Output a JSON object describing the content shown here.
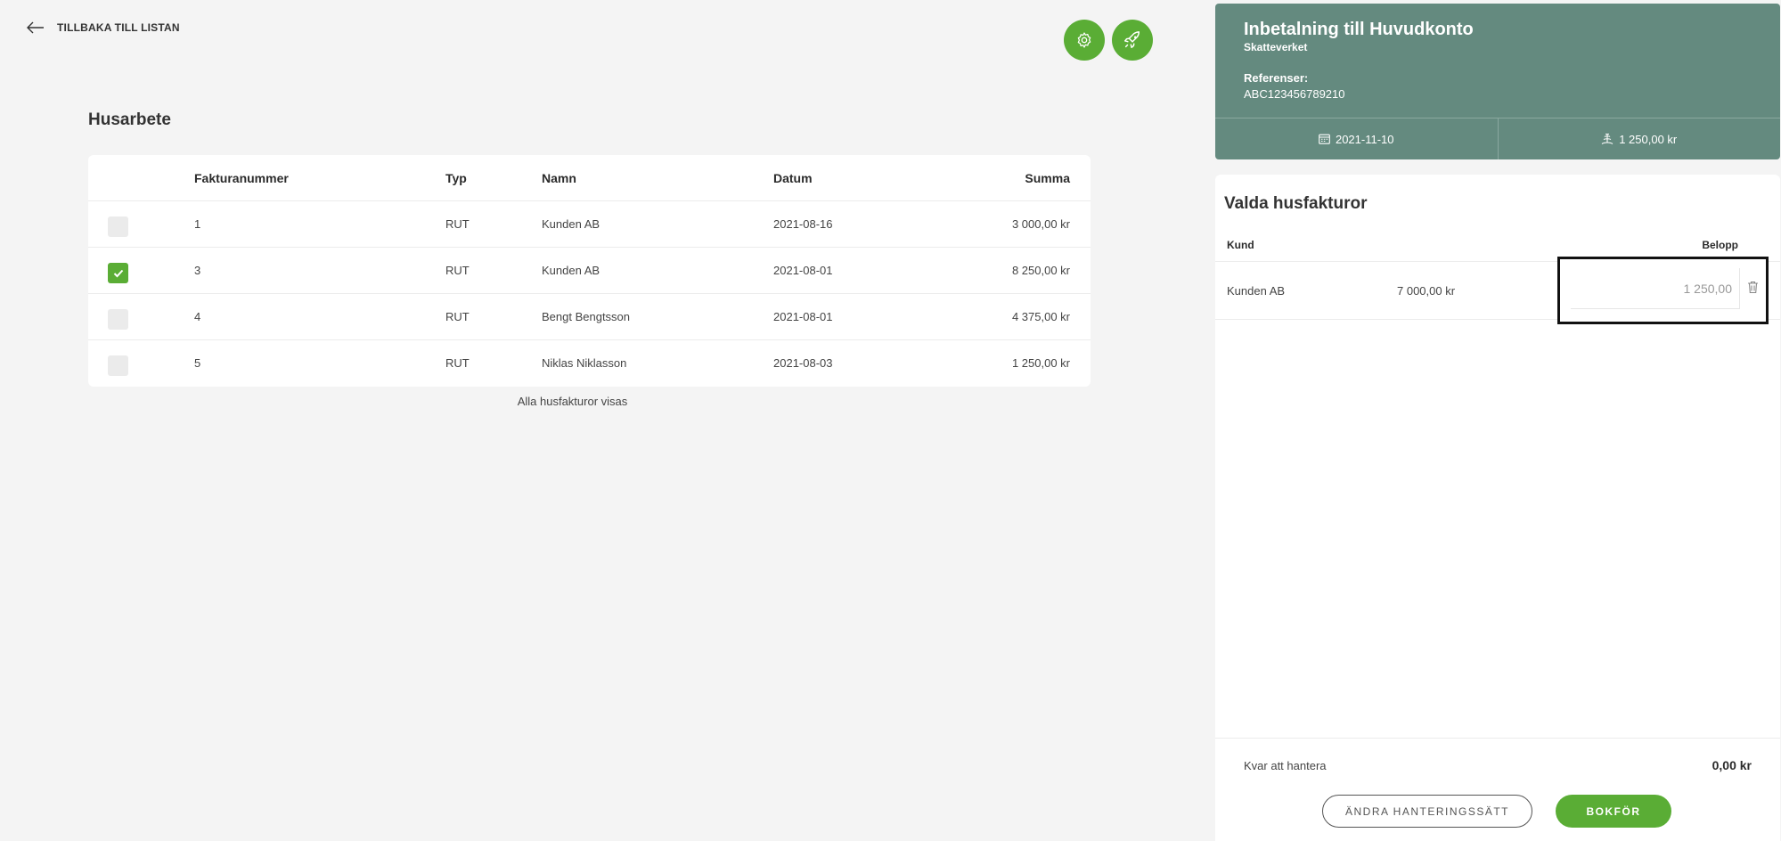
{
  "nav": {
    "back_label": "TILLBAKA TILL LISTAN"
  },
  "toolbar": {
    "settings_icon": "gear-icon",
    "rocket_icon": "rocket-icon"
  },
  "colors": {
    "accent": "#5aad35",
    "header": "#648a7f"
  },
  "section": {
    "title": "Husarbete"
  },
  "table": {
    "columns": {
      "fakturanummer": "Fakturanummer",
      "typ": "Typ",
      "namn": "Namn",
      "datum": "Datum",
      "summa": "Summa"
    },
    "rows": [
      {
        "fakturanummer": "1",
        "typ": "RUT",
        "namn": "Kunden AB",
        "datum": "2021-08-16",
        "summa": "3 000,00 kr",
        "checked": false
      },
      {
        "fakturanummer": "3",
        "typ": "RUT",
        "namn": "Kunden AB",
        "datum": "2021-08-01",
        "summa": "8 250,00 kr",
        "checked": true
      },
      {
        "fakturanummer": "4",
        "typ": "RUT",
        "namn": "Bengt Bengtsson",
        "datum": "2021-08-01",
        "summa": "4 375,00 kr",
        "checked": false
      },
      {
        "fakturanummer": "5",
        "typ": "RUT",
        "namn": "Niklas Niklasson",
        "datum": "2021-08-03",
        "summa": "1 250,00 kr",
        "checked": false
      }
    ],
    "footer_note": "Alla husfakturor visas"
  },
  "payment": {
    "title": "Inbetalning till Huvudkonto",
    "subtitle": "Skatteverket",
    "ref_label": "Referenser:",
    "ref_value": "ABC123456789210",
    "date": "2021-11-10",
    "amount": "1 250,00 kr"
  },
  "selected": {
    "title": "Valda husfakturor",
    "col_kund": "Kund",
    "col_belopp": "Belopp",
    "rows": [
      {
        "kund": "Kunden AB",
        "amount": "7 000,00 kr",
        "belopp_value": "1 250,00"
      }
    ],
    "kvar_label": "Kvar att hantera",
    "kvar_value": "0,00 kr",
    "change_button": "ÄNDRA HANTERINGSSÄTT",
    "book_button": "BOKFÖR"
  }
}
